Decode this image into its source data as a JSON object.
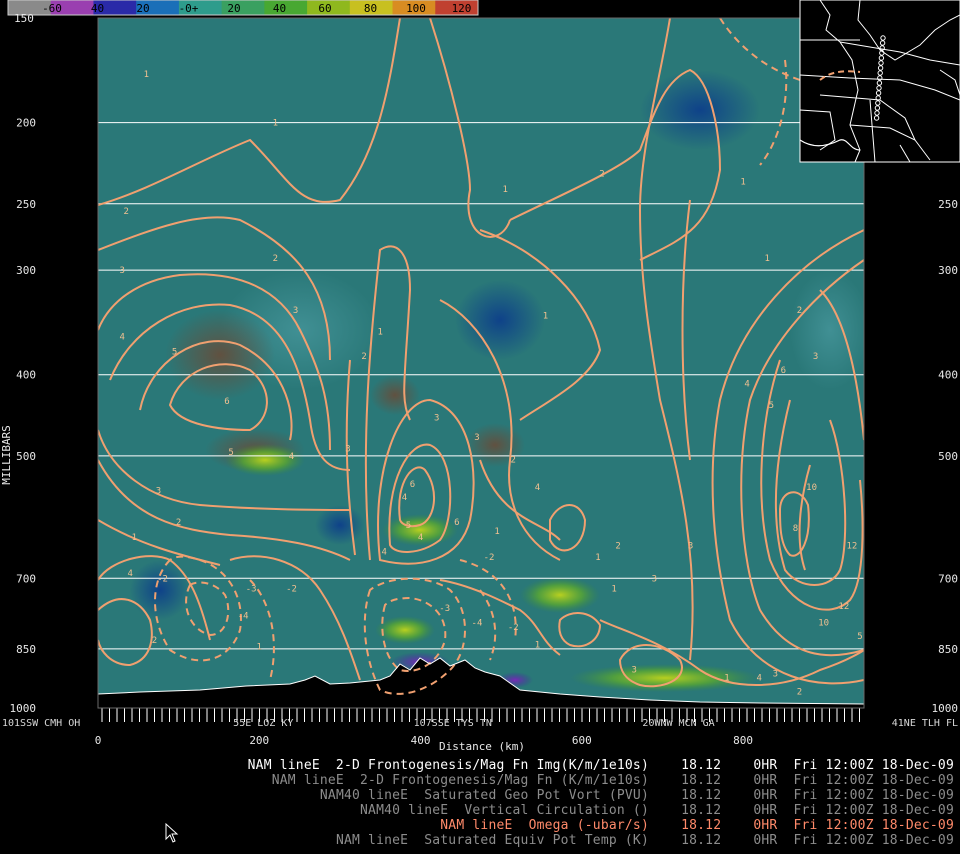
{
  "colorbar": {
    "labels": [
      "-60",
      "40",
      "20",
      "-0+",
      "20",
      "40",
      "60",
      "80",
      "100",
      "120"
    ],
    "colors": [
      "#8a8a8a",
      "#9a3fb0",
      "#2a2aa8",
      "#1a6fb8",
      "#2e9c8c",
      "#3aa060",
      "#48a832",
      "#8fb81e",
      "#c8c020",
      "#d88c22",
      "#c04030"
    ],
    "top_label": "150"
  },
  "axes": {
    "y_title": "MILLIBARS",
    "x_title": "Distance (km)",
    "pressure_levels": [
      {
        "p": 150,
        "label": ""
      },
      {
        "p": 200,
        "label": "200"
      },
      {
        "p": 250,
        "label": "250"
      },
      {
        "p": 300,
        "label": "300"
      },
      {
        "p": 400,
        "label": "400"
      },
      {
        "p": 500,
        "label": "500"
      },
      {
        "p": 700,
        "label": "700"
      },
      {
        "p": 850,
        "label": "850"
      },
      {
        "p": 1000,
        "label": "1000"
      }
    ],
    "x_ticks": [
      {
        "km": 0,
        "label": "0"
      },
      {
        "km": 200,
        "label": "200"
      },
      {
        "km": 400,
        "label": "400"
      },
      {
        "km": 600,
        "label": "600"
      },
      {
        "km": 800,
        "label": "800"
      }
    ],
    "locations": [
      {
        "km": 0,
        "label": "101SSW CMH OH"
      },
      {
        "km": 205,
        "label": "55E LOZ KY"
      },
      {
        "km": 440,
        "label": "107SSE TYS TN"
      },
      {
        "km": 720,
        "label": "20WNW MCN GA"
      },
      {
        "km": 948,
        "label": "41NE TLH FL"
      }
    ]
  },
  "legend": [
    {
      "text": "NAM lineE  2-D Frontogenesis/Mag Fn Img(K/m/1e10s)    18.12    0HR  Fri 12:00Z 18-Dec-09",
      "color": "#ffffff"
    },
    {
      "text": "NAM lineE  2-D Frontogenesis/Mag Fn (K/m/1e10s)    18.12    0HR  Fri 12:00Z 18-Dec-09",
      "color": "#8c8c8c"
    },
    {
      "text": "NAM40 lineE  Saturated Geo Pot Vort (PVU)    18.12    0HR  Fri 12:00Z 18-Dec-09",
      "color": "#8c8c8c"
    },
    {
      "text": "NAM40 lineE  Vertical Circulation ()    18.12    0HR  Fri 12:00Z 18-Dec-09",
      "color": "#8c8c8c"
    },
    {
      "text": "NAM lineE  Omega (-ubar/s)    18.12    0HR  Fri 12:00Z 18-Dec-09",
      "color": "#ff8a6a"
    },
    {
      "text": "NAM lineE  Saturated Equiv Pot Temp (K)    18.12    0HR  Fri 12:00Z 18-Dec-09",
      "color": "#8c8c8c"
    }
  ],
  "chart_data": {
    "type": "heatmap",
    "subtype": "vertical cross-section",
    "x_range_km": [
      0,
      950
    ],
    "y_range_mb": [
      1000,
      150
    ],
    "y_scale": "log-pressure",
    "xlabel": "Distance (km)",
    "ylabel": "MILLIBARS",
    "contour_color": "#f0a070",
    "contour_labels": [
      {
        "km": 60,
        "mb": 175,
        "v": "1"
      },
      {
        "km": 220,
        "mb": 200,
        "v": "1"
      },
      {
        "km": 35,
        "mb": 255,
        "v": "2"
      },
      {
        "km": 30,
        "mb": 300,
        "v": "3"
      },
      {
        "km": 30,
        "mb": 360,
        "v": "4"
      },
      {
        "km": 95,
        "mb": 375,
        "v": "5"
      },
      {
        "km": 160,
        "mb": 430,
        "v": "6"
      },
      {
        "km": 165,
        "mb": 495,
        "v": "5"
      },
      {
        "km": 240,
        "mb": 500,
        "v": "4"
      },
      {
        "km": 310,
        "mb": 490,
        "v": "3"
      },
      {
        "km": 75,
        "mb": 550,
        "v": "3"
      },
      {
        "km": 100,
        "mb": 600,
        "v": "2"
      },
      {
        "km": 45,
        "mb": 625,
        "v": "1"
      },
      {
        "km": 220,
        "mb": 290,
        "v": "2"
      },
      {
        "km": 245,
        "mb": 335,
        "v": "3"
      },
      {
        "km": 350,
        "mb": 355,
        "v": "1"
      },
      {
        "km": 330,
        "mb": 380,
        "v": "2"
      },
      {
        "km": 420,
        "mb": 450,
        "v": "3"
      },
      {
        "km": 470,
        "mb": 475,
        "v": "3"
      },
      {
        "km": 380,
        "mb": 560,
        "v": "4"
      },
      {
        "km": 385,
        "mb": 605,
        "v": "5"
      },
      {
        "km": 445,
        "mb": 600,
        "v": "6"
      },
      {
        "km": 390,
        "mb": 540,
        "v": "6"
      },
      {
        "km": 400,
        "mb": 625,
        "v": "4"
      },
      {
        "km": 355,
        "mb": 650,
        "v": "4"
      },
      {
        "km": 515,
        "mb": 505,
        "v": "2"
      },
      {
        "km": 545,
        "mb": 545,
        "v": "4"
      },
      {
        "km": 505,
        "mb": 240,
        "v": "1"
      },
      {
        "km": 555,
        "mb": 340,
        "v": "1"
      },
      {
        "km": 625,
        "mb": 230,
        "v": "2"
      },
      {
        "km": 800,
        "mb": 235,
        "v": "1"
      },
      {
        "km": 885,
        "mb": 200,
        "v": "-1"
      },
      {
        "km": 830,
        "mb": 290,
        "v": "1"
      },
      {
        "km": 870,
        "mb": 335,
        "v": "2"
      },
      {
        "km": 890,
        "mb": 380,
        "v": "3"
      },
      {
        "km": 805,
        "mb": 410,
        "v": "4"
      },
      {
        "km": 835,
        "mb": 435,
        "v": "5"
      },
      {
        "km": 850,
        "mb": 395,
        "v": "6"
      },
      {
        "km": 885,
        "mb": 545,
        "v": "10"
      },
      {
        "km": 865,
        "mb": 610,
        "v": "8"
      },
      {
        "km": 935,
        "mb": 640,
        "v": "12"
      },
      {
        "km": 925,
        "mb": 755,
        "v": "12"
      },
      {
        "km": 900,
        "mb": 790,
        "v": "10"
      },
      {
        "km": 645,
        "mb": 640,
        "v": "2"
      },
      {
        "km": 690,
        "mb": 700,
        "v": "3"
      },
      {
        "km": 735,
        "mb": 640,
        "v": "3"
      },
      {
        "km": 640,
        "mb": 720,
        "v": "1"
      },
      {
        "km": 665,
        "mb": 900,
        "v": "3"
      },
      {
        "km": 840,
        "mb": 910,
        "v": "3"
      },
      {
        "km": 820,
        "mb": 920,
        "v": "4"
      },
      {
        "km": 870,
        "mb": 955,
        "v": "2"
      },
      {
        "km": 780,
        "mb": 920,
        "v": "1"
      },
      {
        "km": 945,
        "mb": 820,
        "v": "5"
      },
      {
        "km": 40,
        "mb": 690,
        "v": "4"
      },
      {
        "km": 80,
        "mb": 700,
        "v": "-2"
      },
      {
        "km": 190,
        "mb": 720,
        "v": "-3"
      },
      {
        "km": 180,
        "mb": 775,
        "v": "-4"
      },
      {
        "km": 240,
        "mb": 720,
        "v": "-2"
      },
      {
        "km": 70,
        "mb": 830,
        "v": "2"
      },
      {
        "km": 200,
        "mb": 845,
        "v": "1"
      },
      {
        "km": 430,
        "mb": 760,
        "v": "-3"
      },
      {
        "km": 470,
        "mb": 790,
        "v": "-4"
      },
      {
        "km": 485,
        "mb": 660,
        "v": "-2"
      },
      {
        "km": 515,
        "mb": 800,
        "v": "-2"
      },
      {
        "km": 545,
        "mb": 840,
        "v": "1"
      },
      {
        "km": 620,
        "mb": 660,
        "v": "1"
      },
      {
        "km": 495,
        "mb": 615,
        "v": "1"
      }
    ]
  }
}
